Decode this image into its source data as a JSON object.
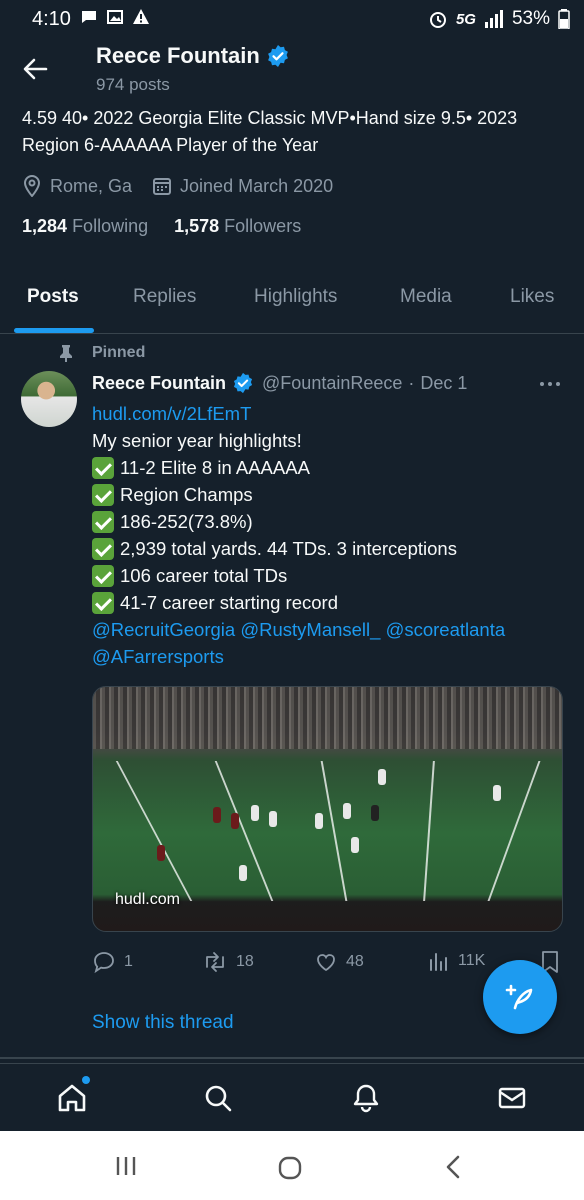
{
  "status_bar": {
    "time": "4:10",
    "network": "5G",
    "battery": "53%"
  },
  "header": {
    "name": "Reece Fountain",
    "posts_count": "974 posts",
    "verified": true
  },
  "profile": {
    "bio": "4.59 40• 2022 Georgia Elite Classic MVP•Hand size 9.5• 2023 Region 6-AAAAAA Player of the Year",
    "location": "Rome, Ga",
    "joined": "Joined March 2020",
    "following_count": "1,284",
    "following_label": "Following",
    "followers_count": "1,578",
    "followers_label": "Followers"
  },
  "tabs": [
    {
      "label": "Posts",
      "active": true
    },
    {
      "label": "Replies",
      "active": false
    },
    {
      "label": "Highlights",
      "active": false
    },
    {
      "label": "Media",
      "active": false
    },
    {
      "label": "Likes",
      "active": false
    }
  ],
  "post": {
    "pinned_label": "Pinned",
    "author": "Reece Fountain",
    "handle": "@FountainReece",
    "separator": "·",
    "date": "Dec 1",
    "link": "hudl.com/v/2LfEmT",
    "intro": "My senior year highlights!",
    "checklist": [
      "11-2 Elite 8 in AAAAAA",
      "Region Champs",
      "186-252(73.8%)",
      "2,939 total yards. 44 TDs. 3 interceptions",
      "106 career total TDs",
      "41-7 career starting record"
    ],
    "mentions_line1": "@RecruitGeorgia @RustyMansell_ @scoreatlanta",
    "mentions_line2": "@AFarrersports",
    "video_label": "hudl.com",
    "replies": "1",
    "reposts": "18",
    "likes": "48",
    "views": "11K",
    "show_thread": "Show this thread"
  },
  "colors": {
    "background": "#15202b",
    "accent": "#1d9bf0",
    "muted": "#8b98a5",
    "text": "#f7f9f9"
  }
}
